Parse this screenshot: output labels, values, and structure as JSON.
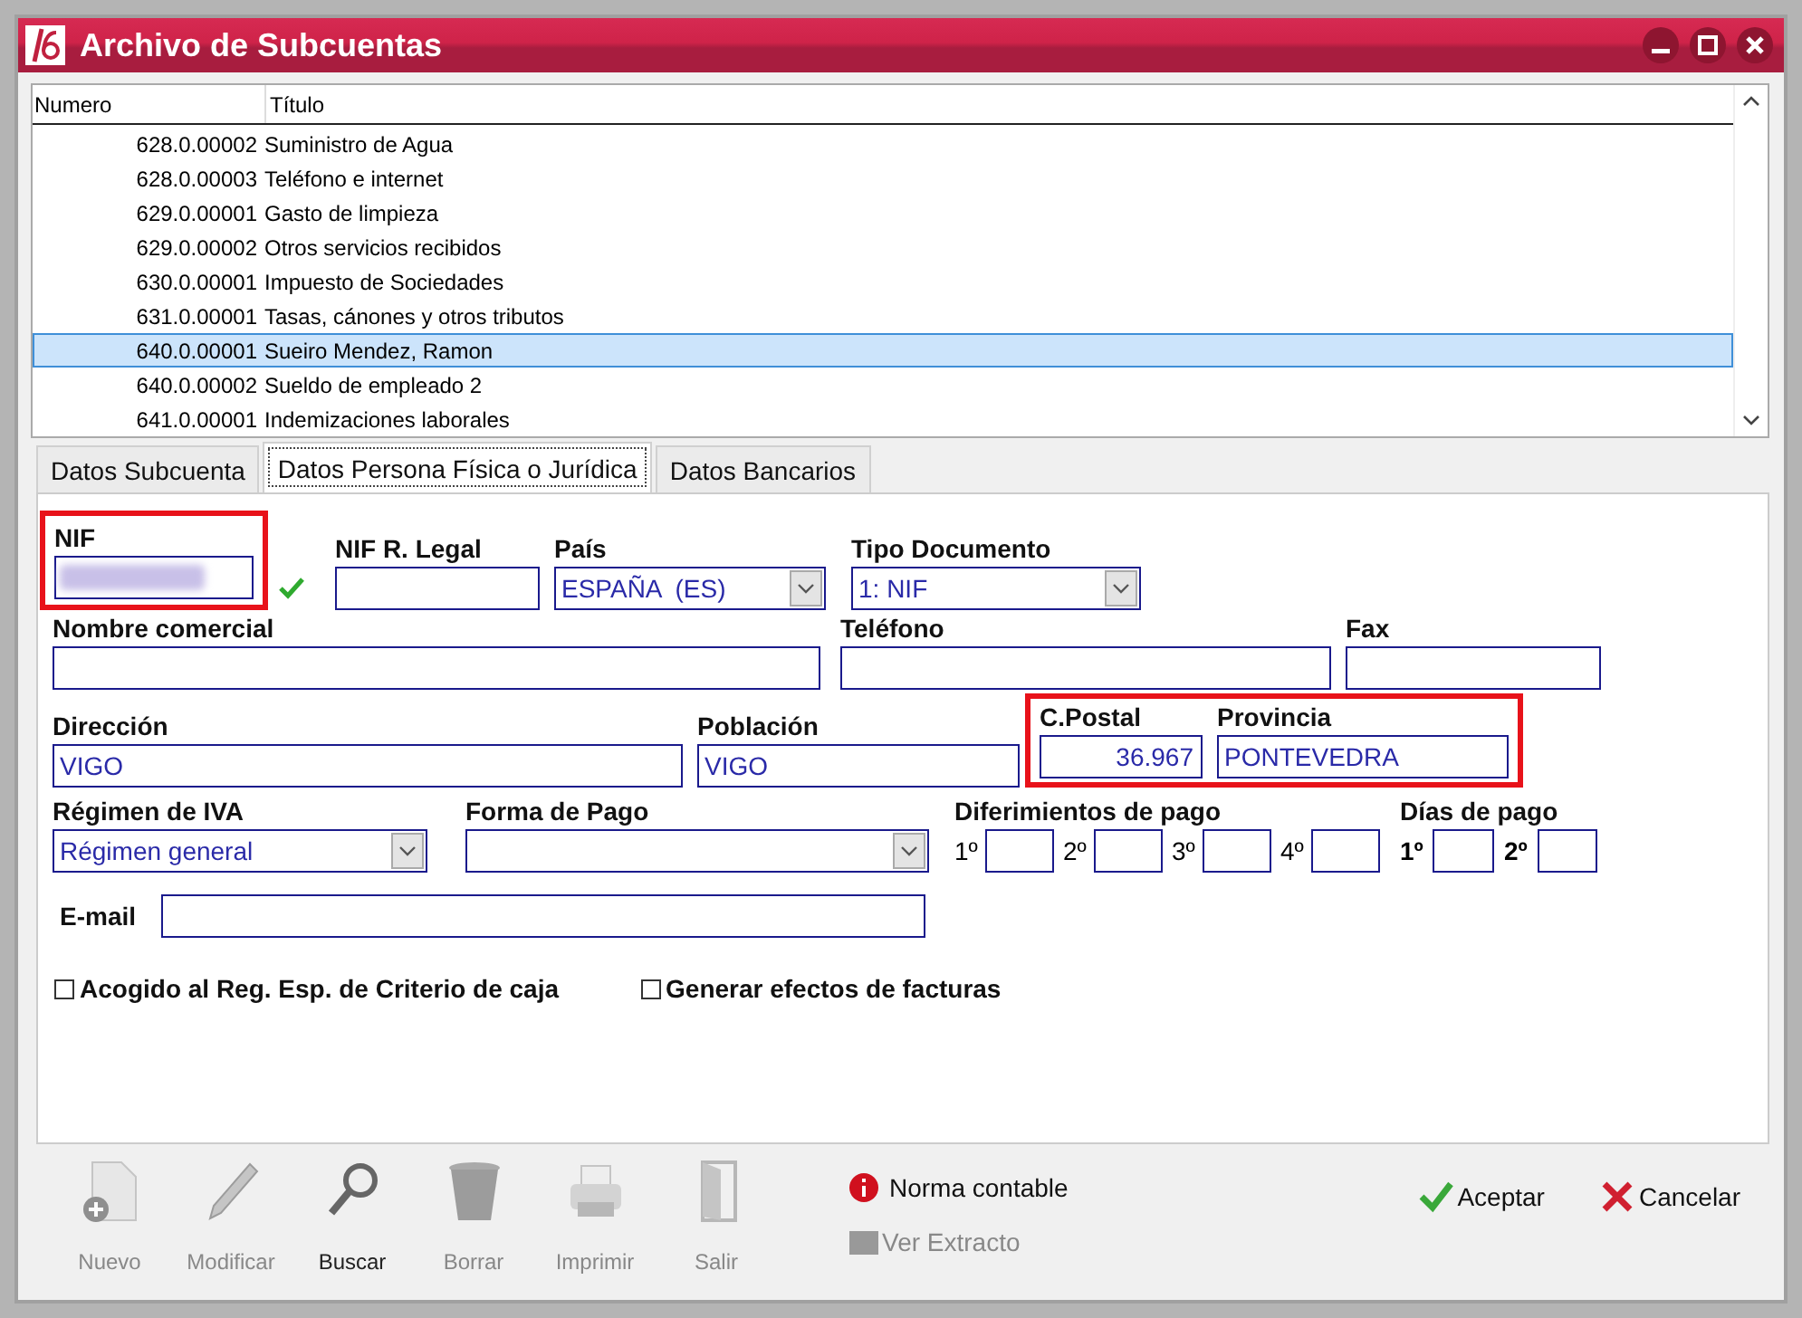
{
  "window": {
    "title": "Archivo de Subcuentas"
  },
  "list": {
    "columns": [
      "Numero",
      "Título"
    ],
    "rows": [
      {
        "numero": "628.0.00002",
        "titulo": "Suministro de Agua",
        "selected": false
      },
      {
        "numero": "628.0.00003",
        "titulo": "Teléfono e internet",
        "selected": false
      },
      {
        "numero": "629.0.00001",
        "titulo": "Gasto de limpieza",
        "selected": false
      },
      {
        "numero": "629.0.00002",
        "titulo": "Otros servicios recibidos",
        "selected": false
      },
      {
        "numero": "630.0.00001",
        "titulo": "Impuesto de Sociedades",
        "selected": false
      },
      {
        "numero": "631.0.00001",
        "titulo": "Tasas, cánones y otros tributos",
        "selected": false
      },
      {
        "numero": "640.0.00001",
        "titulo": "Sueiro Mendez, Ramon",
        "selected": true
      },
      {
        "numero": "640.0.00002",
        "titulo": "Sueldo de empleado 2",
        "selected": false
      },
      {
        "numero": "641.0.00001",
        "titulo": "Indemizaciones laborales",
        "selected": false
      }
    ]
  },
  "tabs": [
    {
      "label": "Datos Subcuenta",
      "selected": false
    },
    {
      "label": "Datos Persona Física o Jurídica",
      "selected": true
    },
    {
      "label": "Datos Bancarios",
      "selected": false
    }
  ],
  "form": {
    "nif": {
      "label": "NIF",
      "highlighted": true,
      "valid": true
    },
    "nif_legal": {
      "label": "NIF R. Legal"
    },
    "pais": {
      "label": "País",
      "value": "ESPAÑA  (ES)"
    },
    "tipo_documento": {
      "label": "Tipo Documento",
      "value": "1: NIF"
    },
    "nombre_comercial": {
      "label": "Nombre comercial"
    },
    "telefono": {
      "label": "Teléfono"
    },
    "fax": {
      "label": "Fax"
    },
    "direccion": {
      "label": "Dirección",
      "value": "VIGO"
    },
    "poblacion": {
      "label": "Población",
      "value": "VIGO"
    },
    "postal_highlighted": true,
    "codigo_postal": {
      "label": "C.Postal",
      "value": "36.967"
    },
    "provincia": {
      "label": "Provincia",
      "value": "PONTEVEDRA"
    },
    "regimen_iva": {
      "label": "Régimen de IVA",
      "value": "Régimen general"
    },
    "forma_pago": {
      "label": "Forma de Pago"
    },
    "diferimientos": {
      "label": "Diferimientos de pago",
      "slots": [
        "1º",
        "2º",
        "3º",
        "4º"
      ]
    },
    "dias_pago": {
      "label": "Días de pago",
      "slots": [
        "1º",
        "2º"
      ]
    },
    "email": {
      "label": "E-mail"
    },
    "checkboxes": [
      {
        "label": "Acogido al Reg. Esp. de Criterio de caja",
        "checked": false
      },
      {
        "label": "Generar efectos de facturas",
        "checked": false
      }
    ]
  },
  "toolbar": [
    {
      "kind": "new",
      "label": "Nuevo",
      "disabled": true
    },
    {
      "kind": "edit",
      "label": "Modificar",
      "disabled": true
    },
    {
      "kind": "search",
      "label": "Buscar",
      "disabled": false
    },
    {
      "kind": "delete",
      "label": "Borrar",
      "disabled": true
    },
    {
      "kind": "print",
      "label": "Imprimir",
      "disabled": true
    },
    {
      "kind": "exit",
      "label": "Salir",
      "disabled": true
    }
  ],
  "norma_contable": {
    "label": "Norma contable"
  },
  "ver_extracto": {
    "label": "Ver Extracto",
    "disabled": true
  },
  "actions": [
    {
      "kind": "accept",
      "label": "Aceptar"
    },
    {
      "kind": "cancel",
      "label": "Cancelar"
    }
  ]
}
